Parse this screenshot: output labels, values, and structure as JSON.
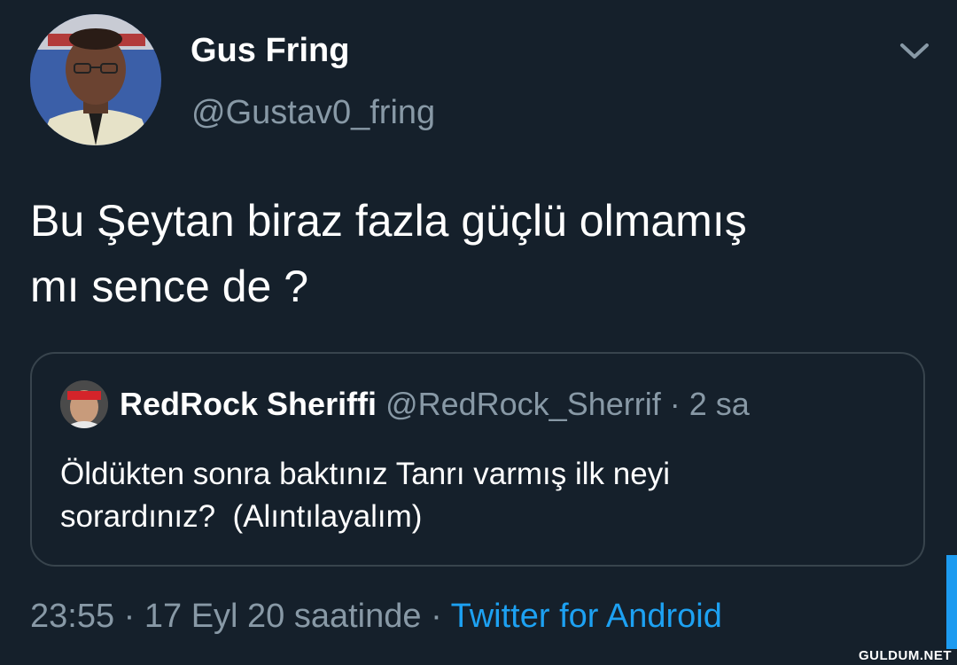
{
  "author": {
    "display_name": "Gus Fring",
    "handle": "@Gustav0_fring",
    "avatar_icon": "profile-photo-man-glasses-tie"
  },
  "tweet": {
    "text_line1": "Bu Şeytan biraz fazla güçlü olmamış",
    "text_line2": "mı sence de ?"
  },
  "quoted_tweet": {
    "display_name": "RedRock Sheriffi",
    "handle": "@RedRock_Sherrif",
    "separator": "·",
    "time": "2 sa",
    "text_line1": "Öldükten sonra baktınız Tanrı varmış ilk neyi",
    "text_line2": "sorardınız?  (Alıntılayalım)",
    "avatar_icon": "profile-photo-red-bandana"
  },
  "meta": {
    "timestamp": "23:55 · 17 Eyl 20 saatinde",
    "separator": " · ",
    "source": "Twitter for Android"
  },
  "watermark": "GULDUM.NET",
  "colors": {
    "background": "#15202b",
    "secondary_text": "#8899a6",
    "link": "#1da1f2",
    "border": "#38444d"
  },
  "icons": {
    "menu": "chevron-down-icon"
  }
}
